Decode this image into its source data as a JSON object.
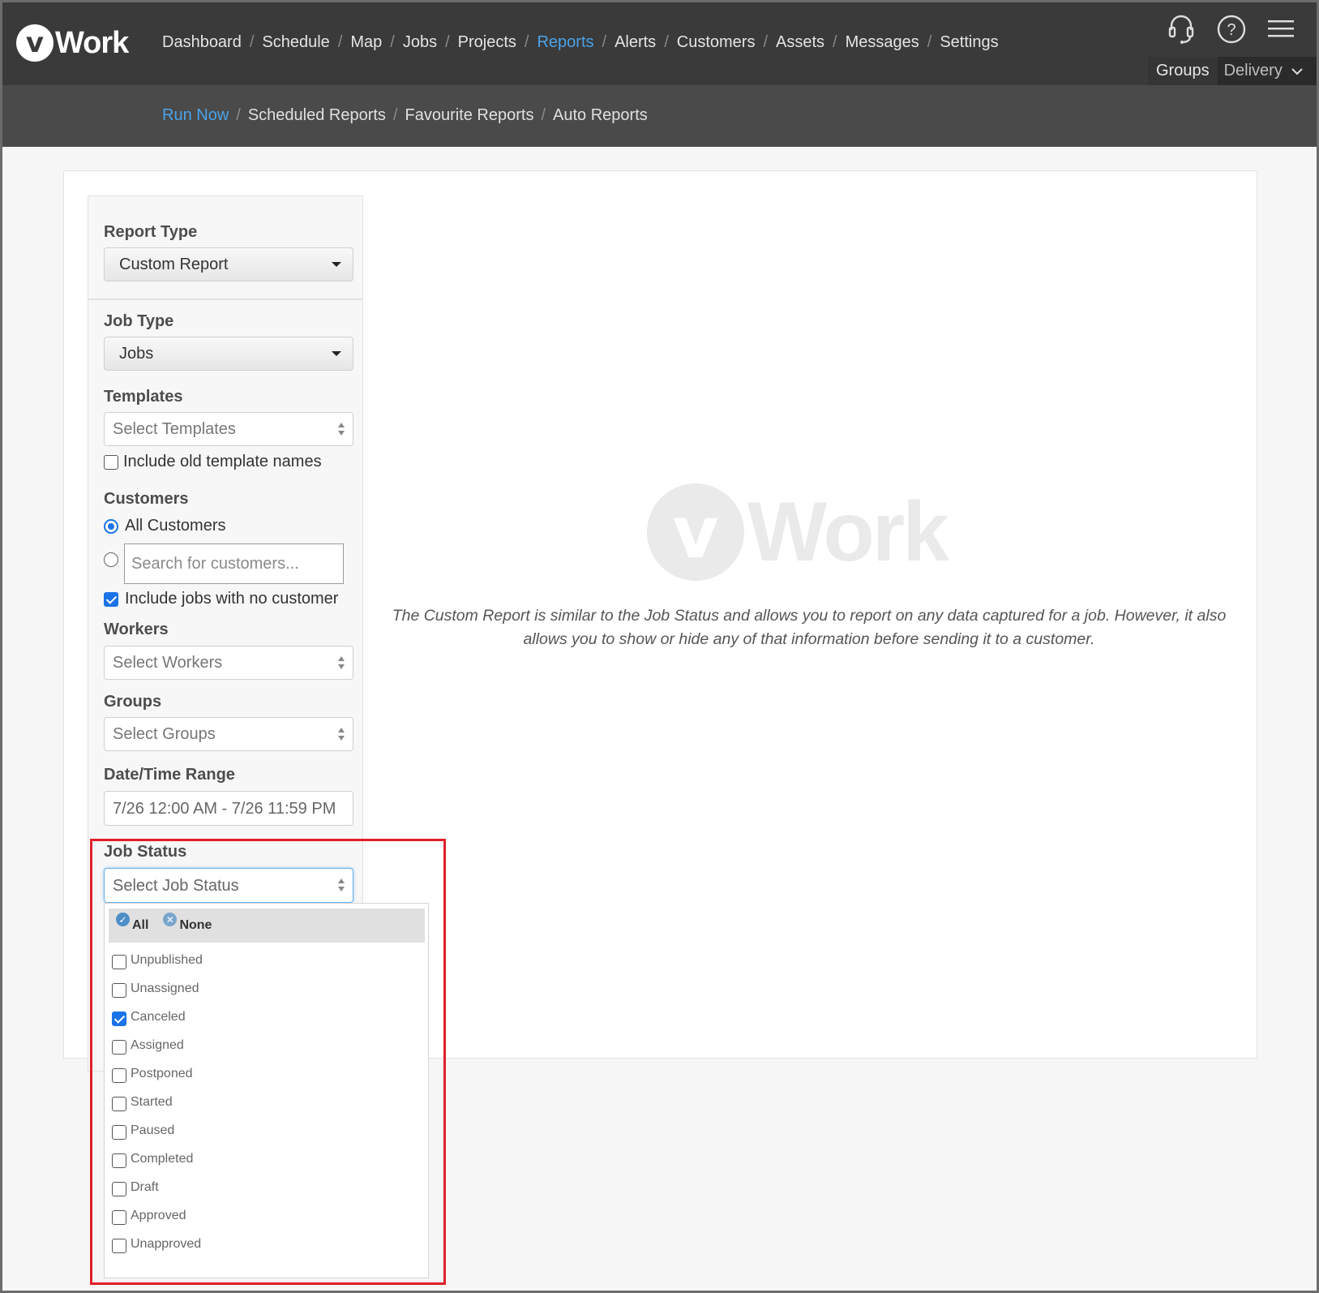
{
  "brand": {
    "logo_letter": "v",
    "logo_text": "Work"
  },
  "main_nav": {
    "items": [
      "Dashboard",
      "Schedule",
      "Map",
      "Jobs",
      "Projects",
      "Reports",
      "Alerts",
      "Customers",
      "Assets",
      "Messages",
      "Settings"
    ],
    "active": "Reports"
  },
  "top_icons": [
    "headset-icon",
    "help-icon",
    "hamburger-menu-icon"
  ],
  "group_bar": {
    "groups_label": "Groups",
    "current_group": "Delivery"
  },
  "sub_nav": {
    "items": [
      "Run Now",
      "Scheduled Reports",
      "Favourite Reports",
      "Auto Reports"
    ],
    "active": "Run Now"
  },
  "sidebar": {
    "report_type": {
      "label": "Report Type",
      "value": "Custom Report"
    },
    "job_type": {
      "label": "Job Type",
      "value": "Jobs"
    },
    "templates": {
      "label": "Templates",
      "placeholder": "Select Templates",
      "include_old_label": "Include old template names",
      "include_old_checked": false
    },
    "customers": {
      "label": "Customers",
      "all_label": "All Customers",
      "all_selected": true,
      "search_placeholder": "Search for customers...",
      "include_no_customer_label": "Include jobs with no customer",
      "include_no_customer_checked": true
    },
    "workers": {
      "label": "Workers",
      "placeholder": "Select Workers"
    },
    "groups": {
      "label": "Groups",
      "placeholder": "Select Groups"
    },
    "date_range": {
      "label": "Date/Time Range",
      "value": "7/26 12:00 AM - 7/26 11:59 PM"
    },
    "job_status": {
      "label": "Job Status",
      "placeholder": "Select Job Status",
      "all_label": "All",
      "none_label": "None",
      "options": [
        {
          "label": "Unpublished",
          "checked": false
        },
        {
          "label": "Unassigned",
          "checked": false
        },
        {
          "label": "Canceled",
          "checked": true
        },
        {
          "label": "Assigned",
          "checked": false
        },
        {
          "label": "Postponed",
          "checked": false
        },
        {
          "label": "Started",
          "checked": false
        },
        {
          "label": "Paused",
          "checked": false
        },
        {
          "label": "Completed",
          "checked": false
        },
        {
          "label": "Draft",
          "checked": false
        },
        {
          "label": "Approved",
          "checked": false
        },
        {
          "label": "Unapproved",
          "checked": false
        }
      ]
    }
  },
  "main": {
    "watermark_letter": "v",
    "watermark_text": "Work",
    "description": "The Custom Report is similar to the Job Status and allows you to report on any data captured for a job. However, it also allows you to show or hide any of that information before sending it to a customer."
  },
  "colors": {
    "accent": "#4aa3ea",
    "topbar": "#3a3a3a",
    "subbar": "#4a4a4a",
    "highlight": "#e0202a",
    "checkbox": "#1a73e8"
  }
}
